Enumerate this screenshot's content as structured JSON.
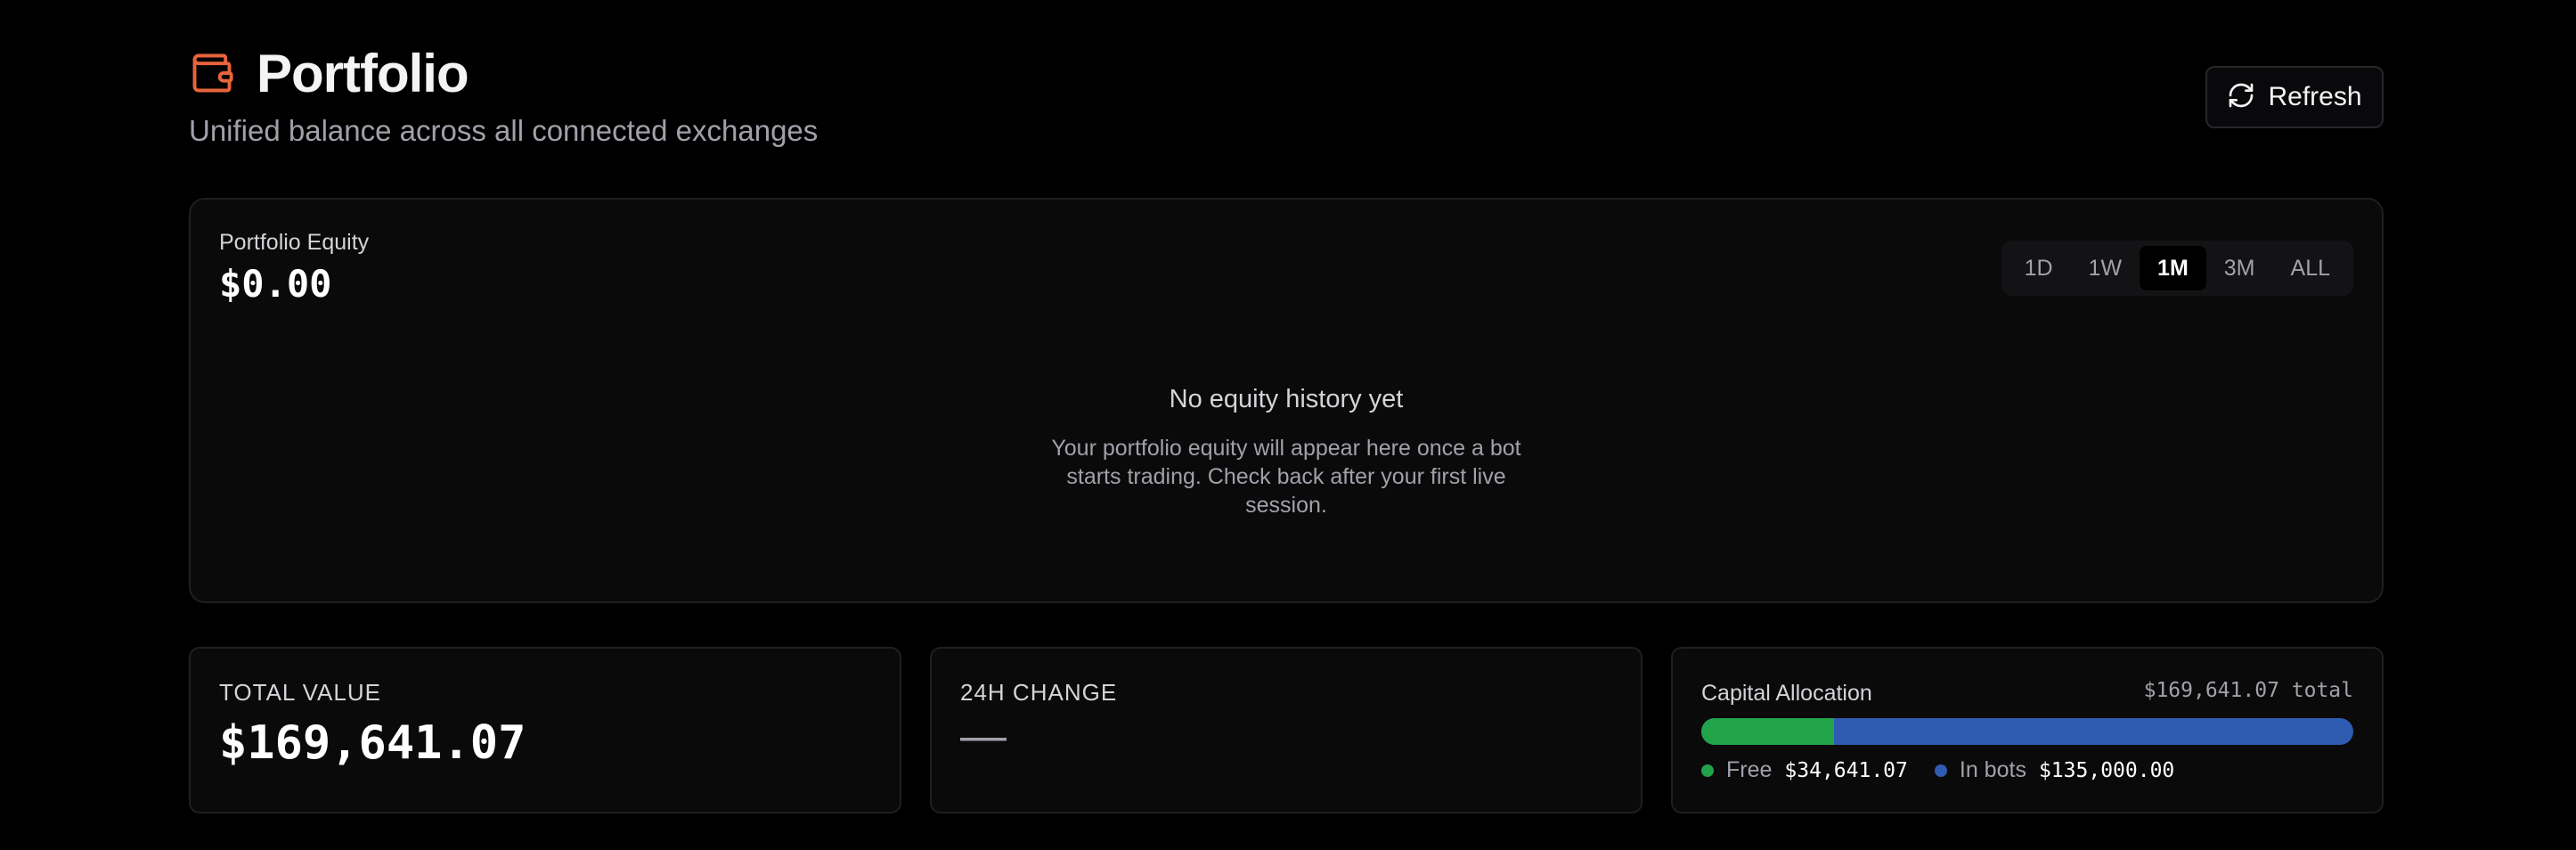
{
  "header": {
    "title": "Portfolio",
    "subtitle": "Unified balance across all connected exchanges",
    "title_icon": "wallet-icon",
    "refresh_label": "Refresh",
    "refresh_icon": "refresh-icon",
    "accent_color": "#e8643c"
  },
  "equity": {
    "label": "Portfolio Equity",
    "value": "$0.00",
    "ranges": [
      "1D",
      "1W",
      "1M",
      "3M",
      "ALL"
    ],
    "selected_range": "1M",
    "empty_title": "No equity history yet",
    "empty_desc": "Your portfolio equity will appear here once a bot starts trading. Check back after your first live session."
  },
  "stats": {
    "total_value_label": "TOTAL VALUE",
    "total_value": "$169,641.07",
    "change_label": "24H CHANGE",
    "change_value": "—"
  },
  "allocation": {
    "title": "Capital Allocation",
    "total": "$169,641.07 total",
    "free_label": "Free",
    "free_value": "$34,641.07",
    "bots_label": "In bots",
    "bots_value": "$135,000.00",
    "free_fraction": 0.2042,
    "free_color": "#22a34a",
    "bots_color": "#2f5bb0"
  }
}
